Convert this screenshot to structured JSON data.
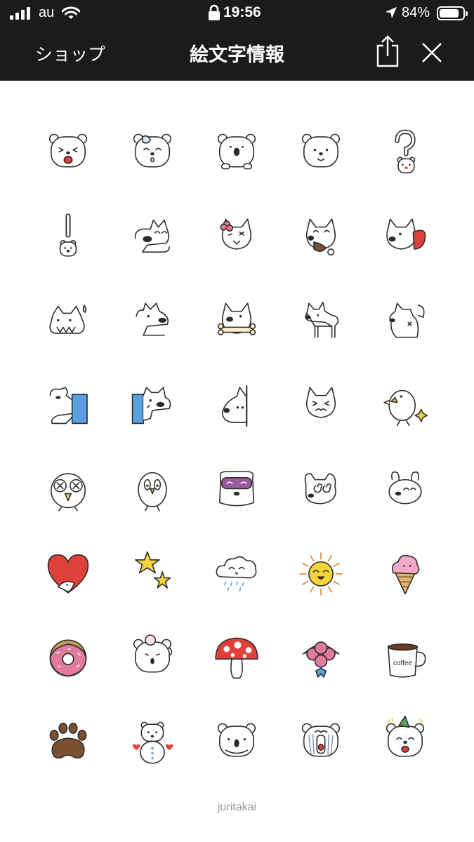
{
  "status_bar": {
    "carrier": "au",
    "time": "19:56",
    "battery_percent": "84%",
    "battery_level": 0.84,
    "signal_bars": 4,
    "icons": [
      "signal-icon",
      "wifi-icon",
      "lock-icon",
      "location-arrow-icon",
      "battery-icon"
    ]
  },
  "nav": {
    "back_label": "ショップ",
    "title": "絵文字情報",
    "icons": [
      "share-icon",
      "close-icon"
    ]
  },
  "emoji_grid": {
    "columns": 5,
    "items": [
      "bear-winking-shout",
      "bear-sweat-drop",
      "bear-peeking",
      "bear-smile",
      "question-mark-bear",
      "exclamation-mark-bear",
      "dog-long-snout-happy",
      "dog-with-pink-flower",
      "dog-eating-meat",
      "dog-with-red-cape",
      "dog-skeleton-sweat",
      "dog-long-snout-grin",
      "dog-with-bone",
      "dog-standing",
      "dog-rear-view",
      "dog-blue-stand-left",
      "dog-blue-stand-right",
      "dog-peeking-wall",
      "dog-grumpy",
      "chick-with-sparkle",
      "owl-dizzy",
      "owl-standing",
      "dog-sleeping-mask",
      "dog-dizzy-swirl",
      "bunny-dog-smile",
      "red-heart-with-dog",
      "yellow-stars",
      "rain-cloud",
      "smiling-sun",
      "pink-ice-cream-cone",
      "pink-donut",
      "bear-with-cup-hat",
      "red-mushroom",
      "rose-bouquet",
      "coffee-mug",
      "brown-paw-print",
      "bear-snowman-hearts",
      "bear-face-front",
      "bear-crying-striped",
      "bear-party-hat"
    ],
    "mug_text": "coffee"
  },
  "footer": {
    "author": "juritakai"
  },
  "colors": {
    "header_bg": "#1b1b1b",
    "outline": "#2a2a2a",
    "red": "#e0403a",
    "pink": "#e07a9e",
    "yellow": "#f7d43a",
    "blue": "#5a9fe0",
    "brown": "#7a5030",
    "purple": "#9b5a9e"
  }
}
